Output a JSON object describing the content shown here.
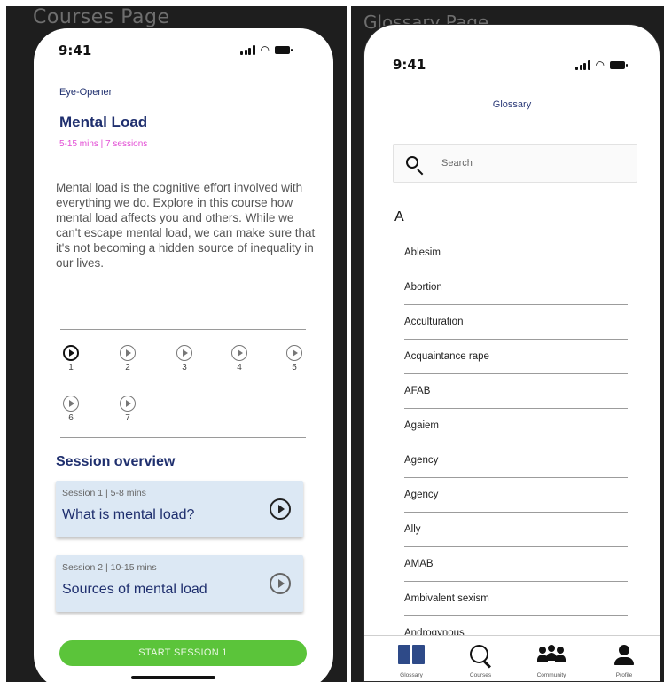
{
  "courses_page": {
    "frame_label": "Courses Page",
    "status_time": "9:41",
    "category": "Eye-Opener",
    "title": "Mental Load",
    "meta": "5-15 mins | 7 sessions",
    "description": "Mental load is the cognitive effort involved with everything we do. Explore in this course how mental load affects you and others. While we can't escape mental load, we can make sure that it's not becoming a hidden source of inequality in our lives.",
    "session_numbers": [
      "1",
      "2",
      "3",
      "4",
      "5",
      "6",
      "7"
    ],
    "overview_title": "Session overview",
    "sessions": [
      {
        "meta": "Session 1 | 5-8 mins",
        "title": "What is mental load?"
      },
      {
        "meta": "Session 2 | 10-15 mins",
        "title": "Sources of mental load"
      }
    ],
    "start_button": "START SESSION 1",
    "accent_color": "#5bc43a",
    "meta_color": "#e24bd4"
  },
  "glossary_page": {
    "frame_label": "Glossary Page",
    "status_time": "9:41",
    "heading": "Glossary",
    "search_placeholder": "Search",
    "letter": "A",
    "terms": [
      "Ablesim",
      "Abortion",
      "Acculturation",
      "Acquaintance rape",
      "AFAB",
      "Agaiem",
      "Agency",
      "Agency",
      "Ally",
      "AMAB",
      "Ambivalent sexism",
      "Androgynous"
    ],
    "tabs": [
      {
        "label": "Glossary",
        "icon": "book-icon"
      },
      {
        "label": "Courses",
        "icon": "search-icon"
      },
      {
        "label": "Community",
        "icon": "community-icon"
      },
      {
        "label": "Profile",
        "icon": "profile-icon"
      }
    ]
  }
}
